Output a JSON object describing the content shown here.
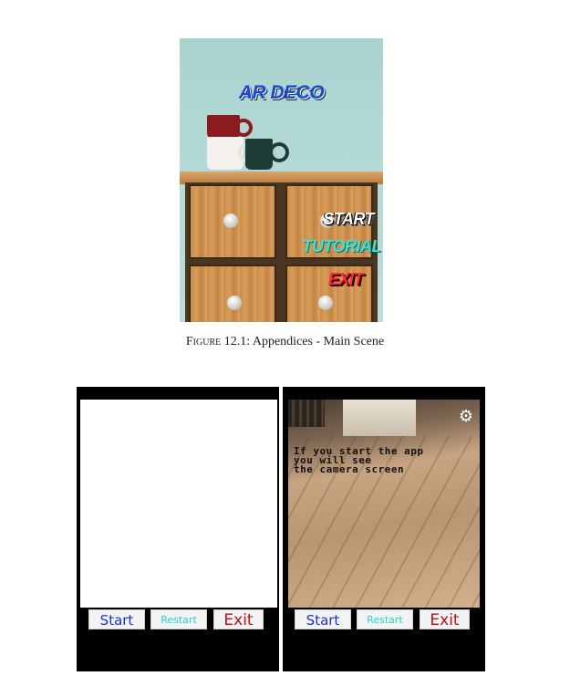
{
  "figure_1": {
    "app_title": "AR DECO",
    "menu": {
      "start": "START",
      "tutorial": "TUTORIAL",
      "exit": "EXIT"
    },
    "colors": {
      "title": "#1b49c9",
      "start": "#ffffff",
      "tutorial": "#40e0d0",
      "exit": "#ff2a2a"
    },
    "caption_label": "Figure 12.1:",
    "caption_text": " Appendices - Main Scene"
  },
  "figure_2": {
    "left_screen": {
      "buttons": {
        "start": "Start",
        "restart": "Restart",
        "exit": "Exit"
      }
    },
    "right_screen": {
      "settings_icon": "gear-icon",
      "message": "If you start the app\nyou will see\nthe camera screen",
      "buttons": {
        "start": "Start",
        "restart": "Restart",
        "exit": "Exit"
      }
    },
    "colors": {
      "start": "#1d2fd6",
      "restart": "#20d6c7",
      "exit": "#b3121c"
    }
  }
}
